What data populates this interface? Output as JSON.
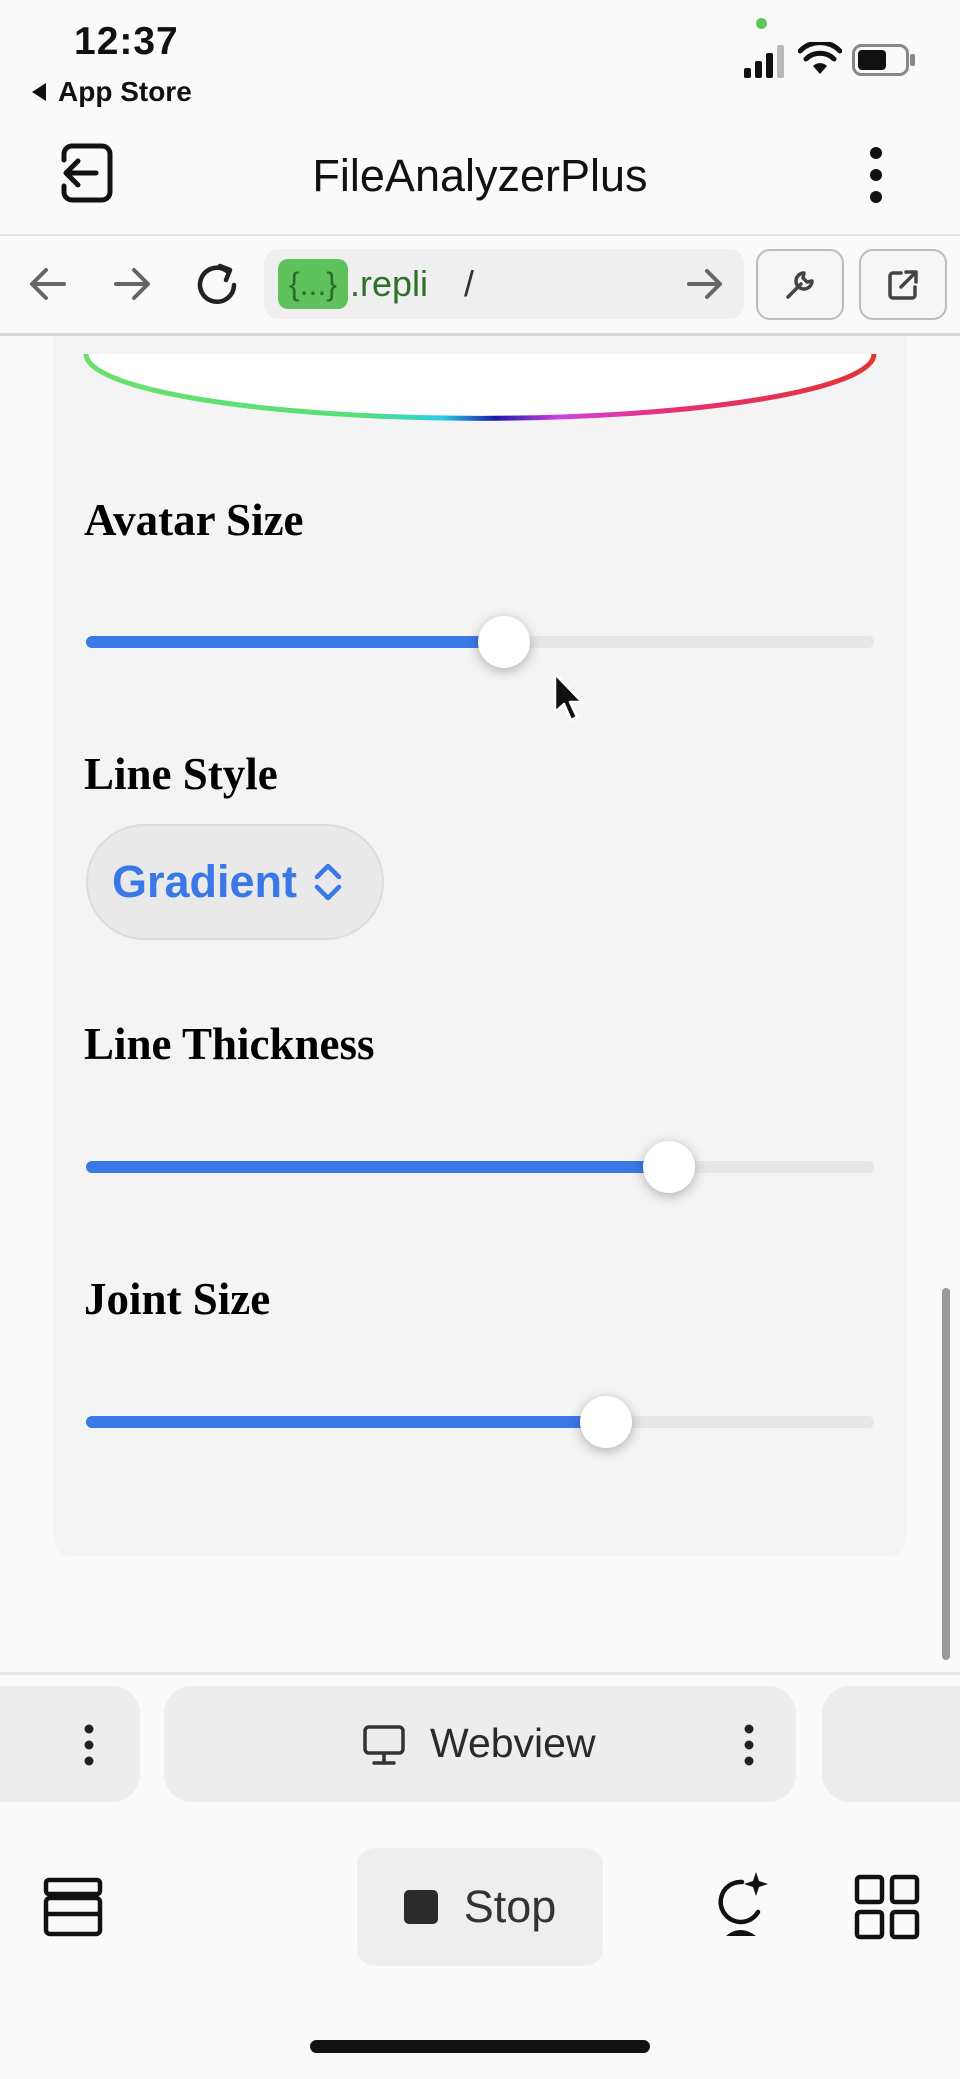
{
  "status_bar": {
    "time": "12:37",
    "back_label": "App Store"
  },
  "header": {
    "title": "FileAnalyzerPlus"
  },
  "browser": {
    "url_chip": "{...}",
    "url_host": ".repli",
    "url_path": "/"
  },
  "settings": {
    "avatar_size": {
      "label": "Avatar Size",
      "value_fraction": 0.53
    },
    "line_style": {
      "label": "Line Style",
      "selected": "Gradient"
    },
    "line_thickness": {
      "label": "Line Thickness",
      "value_fraction": 0.74
    },
    "joint_size": {
      "label": "Joint Size",
      "value_fraction": 0.66
    }
  },
  "tabs": {
    "webview_label": "Webview"
  },
  "toolbar": {
    "stop_label": "Stop"
  },
  "colors": {
    "accent": "#3a78e8",
    "url_chip_bg": "#5fc15b",
    "url_text": "#2e6f2a"
  }
}
